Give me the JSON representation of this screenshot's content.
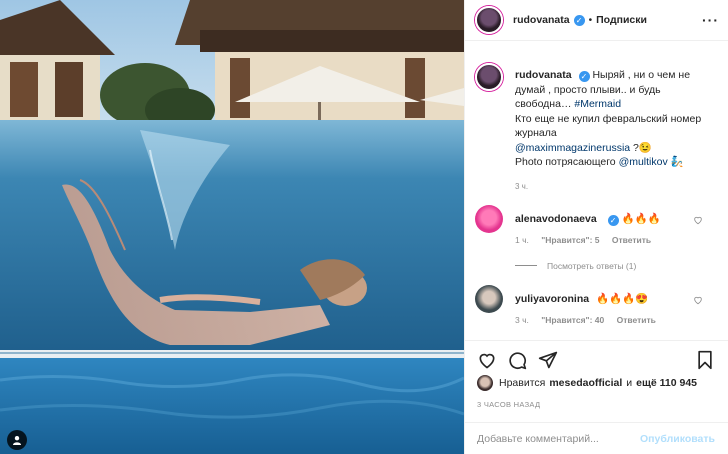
{
  "post": {
    "author": "rudovanata",
    "follow_label": "Подписки",
    "separator": "•",
    "more_label": "···"
  },
  "caption": {
    "username": "rudovanata",
    "line1": "Ныряй , ни о чем не думай , просто плыви.. и будь свободна…",
    "hashtag": "#Mermaid",
    "line2": "Кто еще не купил февральский номер журнала",
    "mention1": "@maximmagazinerussia",
    "line3": "?😉",
    "line4_prefix": "Photo потрясающего",
    "mention2": "@multikov",
    "line4_suffix": "🧞",
    "time": "3 ч."
  },
  "comments": [
    {
      "username": "alenavodonaeva",
      "text": "🔥🔥🔥",
      "time": "1 ч.",
      "likes": "\"Нравится\": 5",
      "reply": "Ответить",
      "view_replies": "Посмотреть ответы (1)",
      "avatar_color": "#e4358f"
    },
    {
      "username": "yuliyavoronina",
      "text": "🔥🔥🔥😍",
      "time": "3 ч.",
      "likes": "\"Нравится\": 40",
      "reply": "Ответить",
      "avatar_color": "#3d4a4f"
    }
  ],
  "likes": {
    "prefix": "Нравится",
    "user": "mesedaofficial",
    "joiner": "и",
    "rest": "ещё 110 945"
  },
  "date": "3 ЧАСОВ НАЗАД",
  "add_comment": {
    "placeholder": "Добавьте комментарий...",
    "post_label": "Опубликовать"
  },
  "icons": [
    "heart-icon",
    "comment-icon",
    "share-icon",
    "bookmark-icon",
    "user-tag-icon",
    "verified-icon",
    "small-heart-icon"
  ],
  "colors": {
    "link": "#00376b",
    "muted": "#8e8e8e",
    "verified": "#3897f0",
    "post_disabled": "#b2dffc"
  }
}
